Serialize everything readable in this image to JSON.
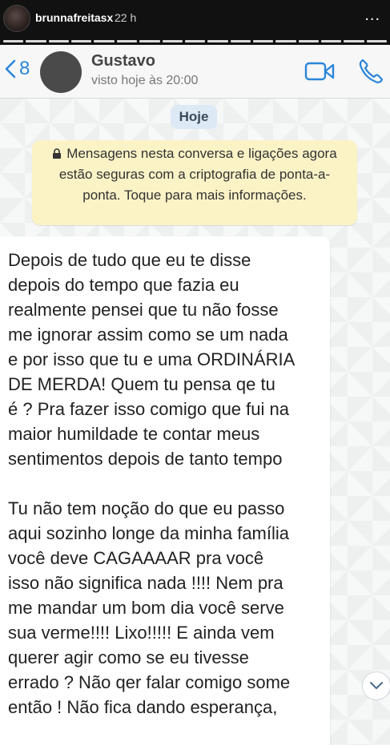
{
  "story": {
    "username": "brunnafreitasx",
    "time": "22 h",
    "more_label": "...",
    "avatar_icon": "avatar",
    "more_icon": "more-horizontal-icon"
  },
  "chat_header": {
    "back_count": "8",
    "back_icon": "chevron-left-icon",
    "contact_name": "Gustavo",
    "status": "visto hoje às 20:00",
    "video_icon": "video-call-icon",
    "phone_icon": "phone-icon"
  },
  "chat": {
    "date_label": "Hoje",
    "security_notice": "Mensagens nesta conversa e ligações agora estão seguras com a criptografia de ponta-a-ponta. Toque para mais informações.",
    "message_text": "Depois de tudo que eu te disse\ndepois do tempo que fazia eu\nrealmente pensei que tu não fosse\nme ignorar assim como se um nada\ne por isso que tu e uma ORDINÁRIA\nDE MERDA! Quem tu pensa qe tu\né ? Pra fazer isso comigo que fui na\nmaior humildade te contar meus\nsentimentos depois de tanto tempo\n\nTu não tem noção do que eu passo\naqui sozinho longe da minha família\nvocê deve CAGAAAAR pra você\nisso não significa nada !!!! Nem pra\nme mandar um bom dia você serve\nsua verme!!!! Lixo!!!!! E ainda vem\nquerer agir como se eu tivesse\nerrado ? Não qer falar comigo some\nentão ! Não fica dando esperança,",
    "scroll_icon": "chevron-down-icon"
  },
  "colors": {
    "accent": "#2b86d9",
    "notice_bg": "#fbf3c6",
    "date_bg": "#dde9f5"
  }
}
